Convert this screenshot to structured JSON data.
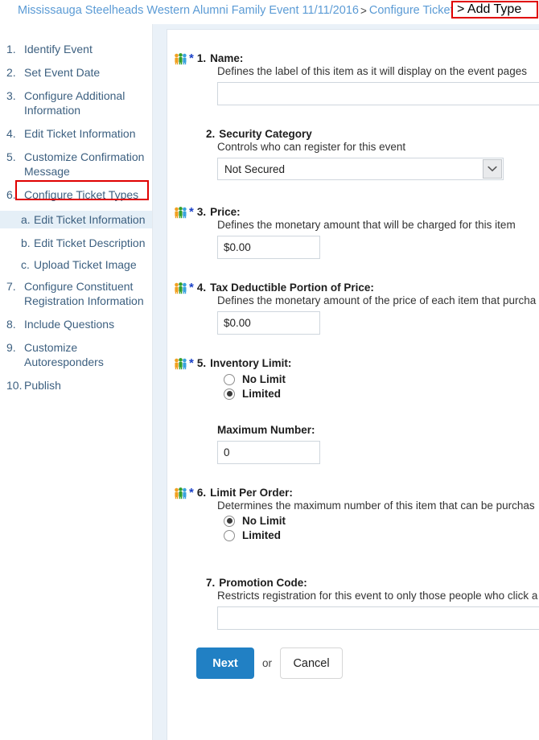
{
  "breadcrumb": {
    "event_link": "Mississauga Steelheads Western Alumni Family Event 11/11/2016",
    "sep1": ">",
    "configure_link": "Configure Ticket Type",
    "current": "> Add Type",
    "highlight_color": "#e00000",
    "link_color": "#5b9bd5"
  },
  "sidebar": {
    "items": [
      {
        "num": "1.",
        "label": "Identify Event",
        "sub": false,
        "active": false
      },
      {
        "num": "2.",
        "label": "Set Event Date",
        "sub": false,
        "active": false
      },
      {
        "num": "3.",
        "label": "Configure Additional Information",
        "sub": false,
        "active": false
      },
      {
        "num": "4.",
        "label": "Edit Ticket Information",
        "sub": false,
        "active": false
      },
      {
        "num": "5.",
        "label": "Customize Confirmation Message",
        "sub": false,
        "active": false
      },
      {
        "num": "6.",
        "label": "Configure Ticket Types",
        "sub": false,
        "active": false
      },
      {
        "num": "a.",
        "label": "Edit Ticket Information",
        "sub": true,
        "active": true
      },
      {
        "num": "b.",
        "label": "Edit Ticket Description",
        "sub": true,
        "active": false
      },
      {
        "num": "c.",
        "label": "Upload Ticket Image",
        "sub": true,
        "active": false
      },
      {
        "num": "7.",
        "label": "Configure Constituent Registration Information",
        "sub": false,
        "active": false
      },
      {
        "num": "8.",
        "label": "Include Questions",
        "sub": false,
        "active": false
      },
      {
        "num": "9.",
        "label": "Customize Autoresponders",
        "sub": false,
        "active": false
      },
      {
        "num": "10.",
        "label": "Publish",
        "sub": false,
        "active": false
      }
    ],
    "highlight_color": "#e00000",
    "active_row_bg": "#e5eff7"
  },
  "form": {
    "name": {
      "number": "1.",
      "title": "Name:",
      "description": "Defines the label of this item as it will display on the event pages",
      "value": "",
      "required": true,
      "icon": "people-icon",
      "star": "*"
    },
    "security_category": {
      "number": "2.",
      "title": "Security Category",
      "description": "Controls who can register for this event",
      "selected": "Not Secured",
      "required": false
    },
    "price": {
      "number": "3.",
      "title": "Price:",
      "description": "Defines the monetary amount that will be charged for this item",
      "value": "$0.00",
      "required": true,
      "icon": "people-icon",
      "star": "*"
    },
    "tax_deductible": {
      "number": "4.",
      "title": "Tax Deductible Portion of Price:",
      "description": "Defines the monetary amount of the price of each item that purcha",
      "value": "$0.00",
      "required": true,
      "icon": "people-icon",
      "star": "*"
    },
    "inventory_limit": {
      "number": "5.",
      "title": "Inventory Limit:",
      "required": true,
      "icon": "people-icon",
      "star": "*",
      "options": [
        {
          "label": "No Limit",
          "selected": false
        },
        {
          "label": "Limited",
          "selected": true
        }
      ],
      "max_number_label": "Maximum Number:",
      "max_number_value": "0"
    },
    "limit_per_order": {
      "number": "6.",
      "title": "Limit Per Order:",
      "description": "Determines the maximum number of this item that can be purchas",
      "required": true,
      "icon": "people-icon",
      "star": "*",
      "options": [
        {
          "label": "No Limit",
          "selected": true
        },
        {
          "label": "Limited",
          "selected": false
        }
      ]
    },
    "promotion_code": {
      "number": "7.",
      "title": "Promotion Code:",
      "description": "Restricts registration for this event to only those people who click a",
      "value": "",
      "required": false
    }
  },
  "actions": {
    "next_label": "Next",
    "or_label": "or",
    "cancel_label": "Cancel",
    "primary_color": "#2180c4"
  }
}
